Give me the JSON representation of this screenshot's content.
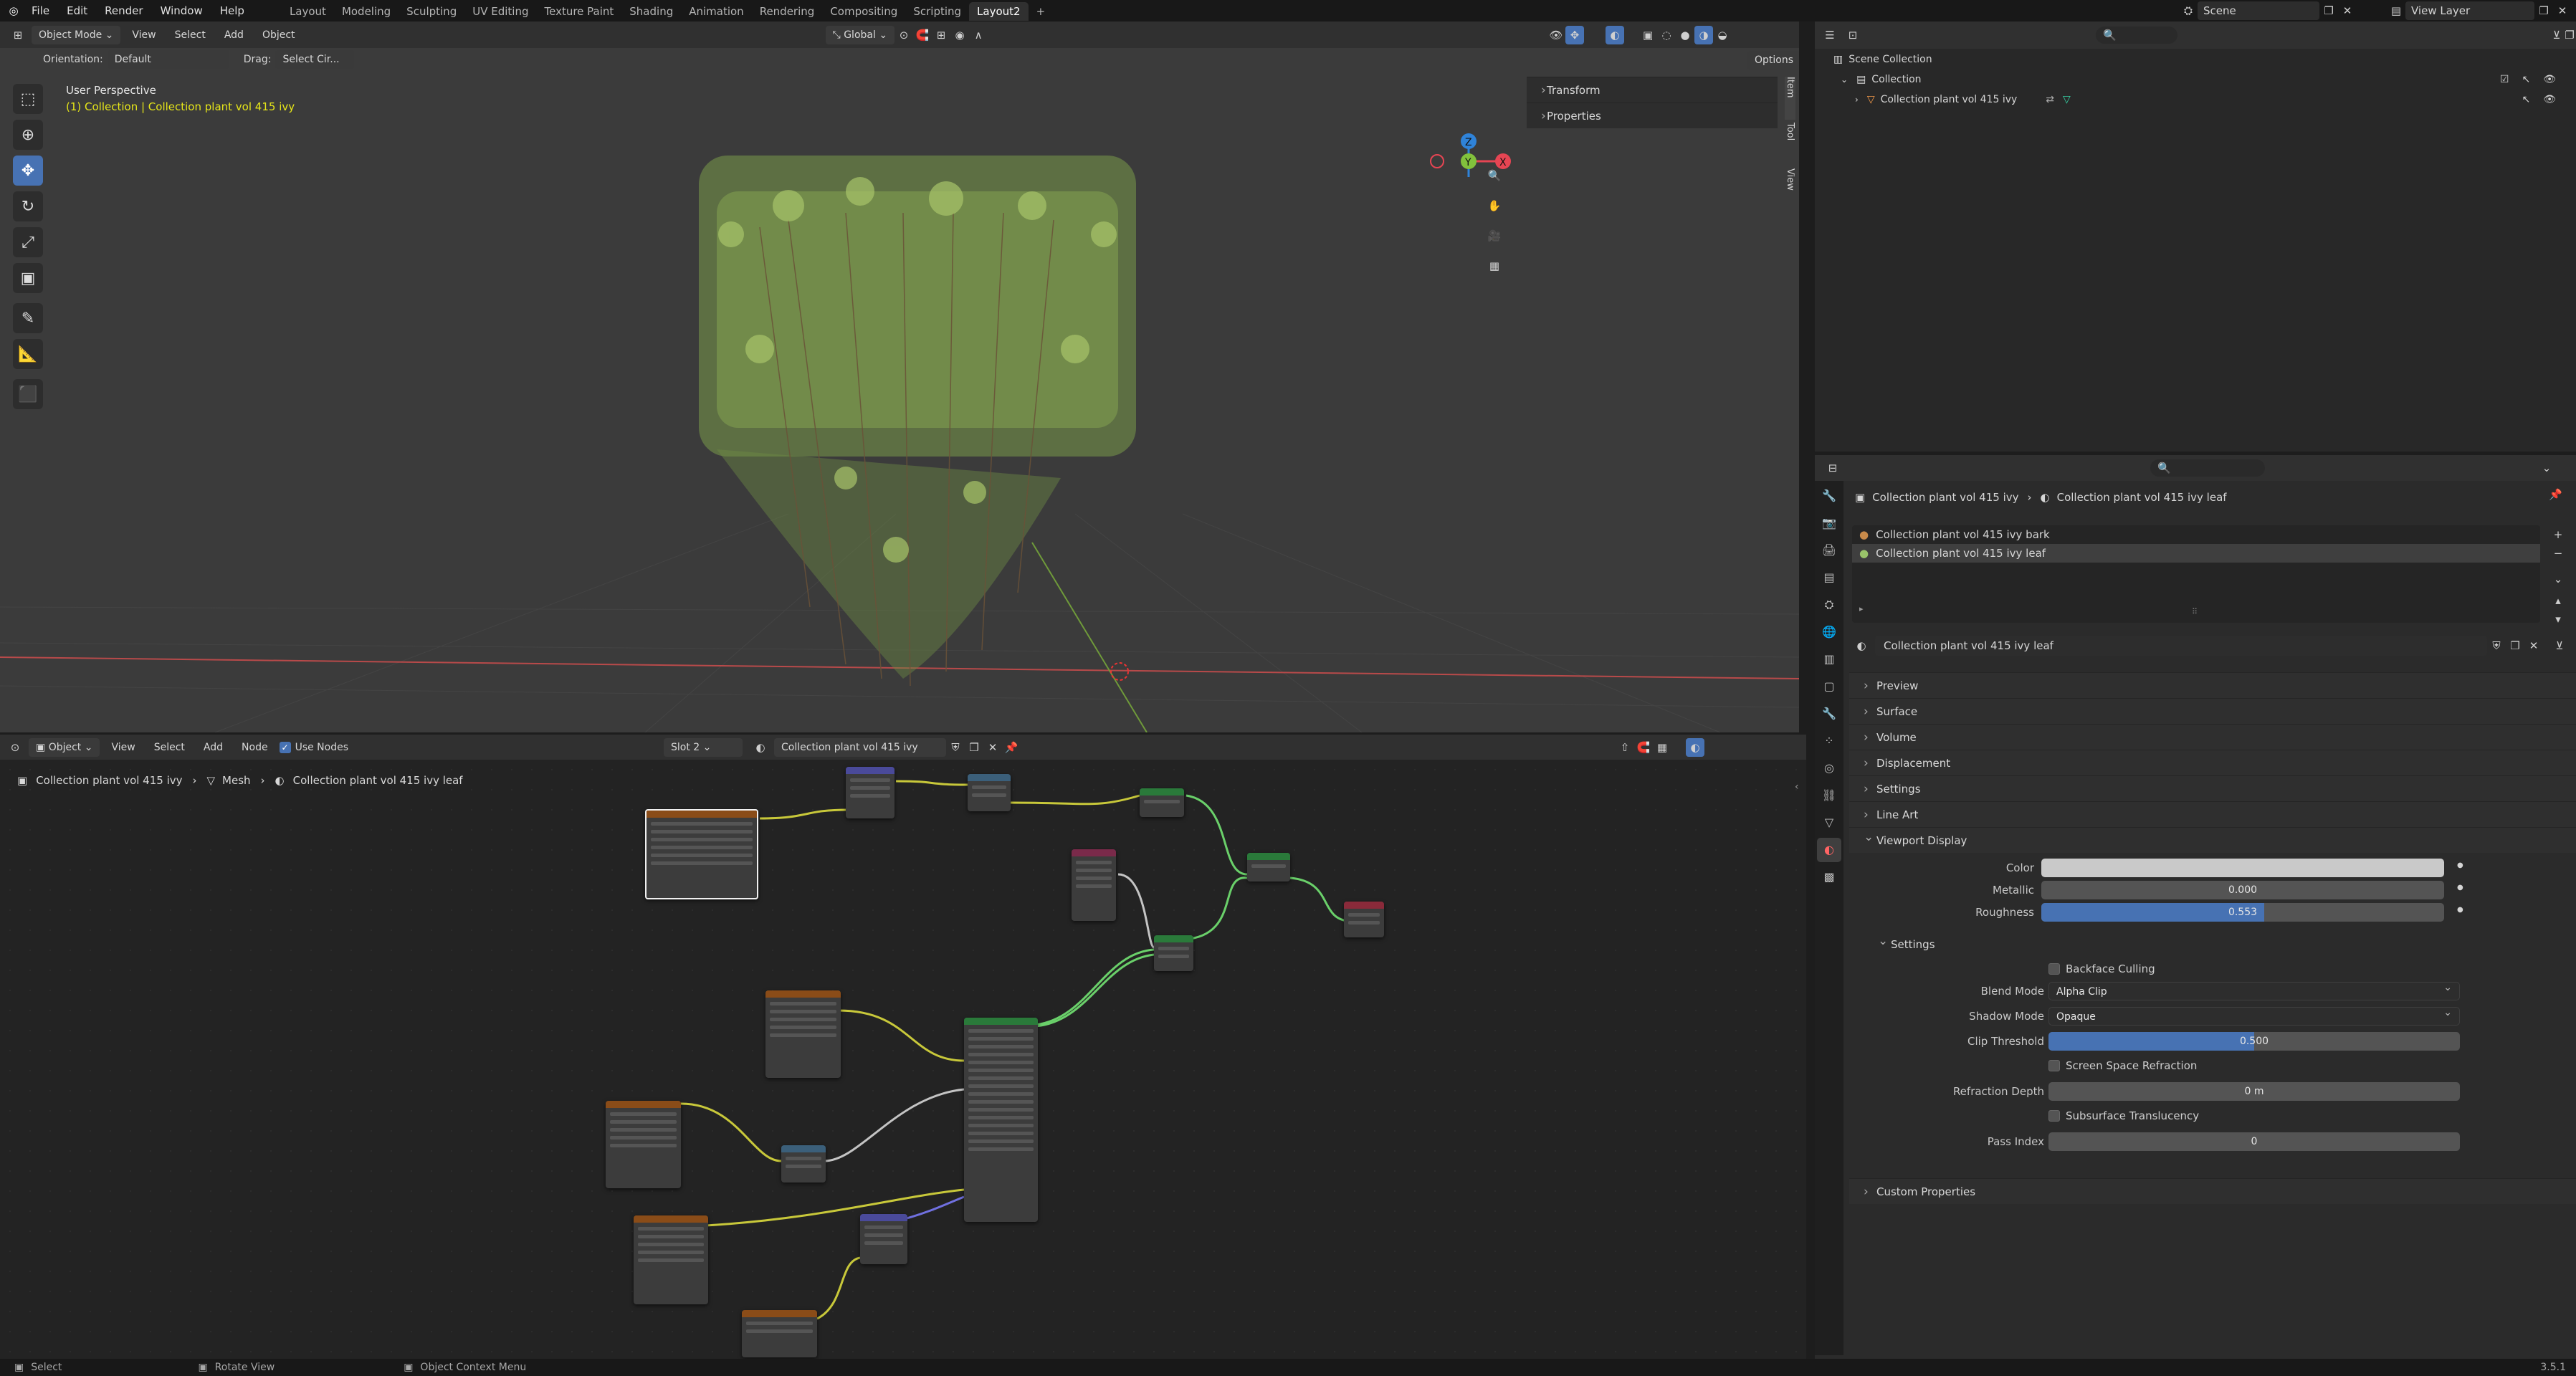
{
  "topbar": {
    "menus": [
      "File",
      "Edit",
      "Render",
      "Window",
      "Help"
    ],
    "workspaces": [
      "Layout",
      "Modeling",
      "Sculpting",
      "UV Editing",
      "Texture Paint",
      "Shading",
      "Animation",
      "Rendering",
      "Compositing",
      "Scripting",
      "Layout2"
    ],
    "active_workspace": "Layout2",
    "add_tab": "+",
    "scene": "Scene",
    "view_layer": "View Layer"
  },
  "viewport_header": {
    "mode": "Object Mode",
    "menus": [
      "View",
      "Select",
      "Add",
      "Object"
    ],
    "transform_orientation": "Global"
  },
  "tool_settings": {
    "orientation_label": "Orientation:",
    "orientation_value": "Default",
    "drag_label": "Drag:",
    "drag_value": "Select Cir...",
    "options": "Options"
  },
  "viewport": {
    "perspective": "User Perspective",
    "collection_info": "(1) Collection | Collection plant vol 415 ivy",
    "sidebar_panels": [
      "Transform",
      "Properties"
    ],
    "sidebar_tabs": [
      "Item",
      "Tool",
      "View"
    ],
    "gizmo_axes": [
      "Z",
      "Y",
      "X"
    ]
  },
  "node_header": {
    "editor_type": "Object",
    "menus": [
      "View",
      "Select",
      "Add",
      "Node"
    ],
    "use_nodes": "Use Nodes",
    "slot": "Slot 2",
    "material": "Collection plant vol 415 ivy leaf"
  },
  "node_breadcrumb": {
    "object": "Collection plant vol 415 ivy",
    "mesh": "Mesh",
    "material": "Collection plant vol 415 ivy leaf"
  },
  "outliner": {
    "root": "Scene Collection",
    "collection": "Collection",
    "object": "Collection plant vol 415 ivy"
  },
  "properties": {
    "breadcrumb_object": "Collection plant vol 415 ivy",
    "breadcrumb_material": "Collection plant vol 415 ivy leaf",
    "material_slots": [
      "Collection plant vol 415 ivy bark",
      "Collection plant vol 415 ivy leaf"
    ],
    "material_name": "Collection plant vol 415 ivy leaf",
    "panels_closed": [
      "Preview",
      "Surface",
      "Volume",
      "Displacement",
      "Settings",
      "Line Art"
    ],
    "viewport_display": "Viewport Display",
    "color_label": "Color",
    "metallic_label": "Metallic",
    "metallic_value": "0.000",
    "roughness_label": "Roughness",
    "roughness_value": "0.553",
    "roughness_fraction": 0.553,
    "settings_sub": "Settings",
    "backface_culling": "Backface Culling",
    "blend_mode_label": "Blend Mode",
    "blend_mode": "Alpha Clip",
    "shadow_mode_label": "Shadow Mode",
    "shadow_mode": "Opaque",
    "clip_threshold_label": "Clip Threshold",
    "clip_threshold": "0.500",
    "clip_threshold_fraction": 0.5,
    "screen_space_refraction": "Screen Space Refraction",
    "refraction_depth_label": "Refraction Depth",
    "refraction_depth": "0 m",
    "subsurface_translucency": "Subsurface Translucency",
    "pass_index_label": "Pass Index",
    "pass_index": "0",
    "custom_properties": "Custom Properties"
  },
  "statusbar": {
    "select": "Select",
    "rotate": "Rotate View",
    "context": "Object Context Menu",
    "version": "3.5.1"
  },
  "colors": {
    "accent": "#4772b3",
    "active_text": "#e6e619",
    "x_axis": "#e64553",
    "y_axis": "#82c13c",
    "z_axis": "#2f83d9"
  }
}
